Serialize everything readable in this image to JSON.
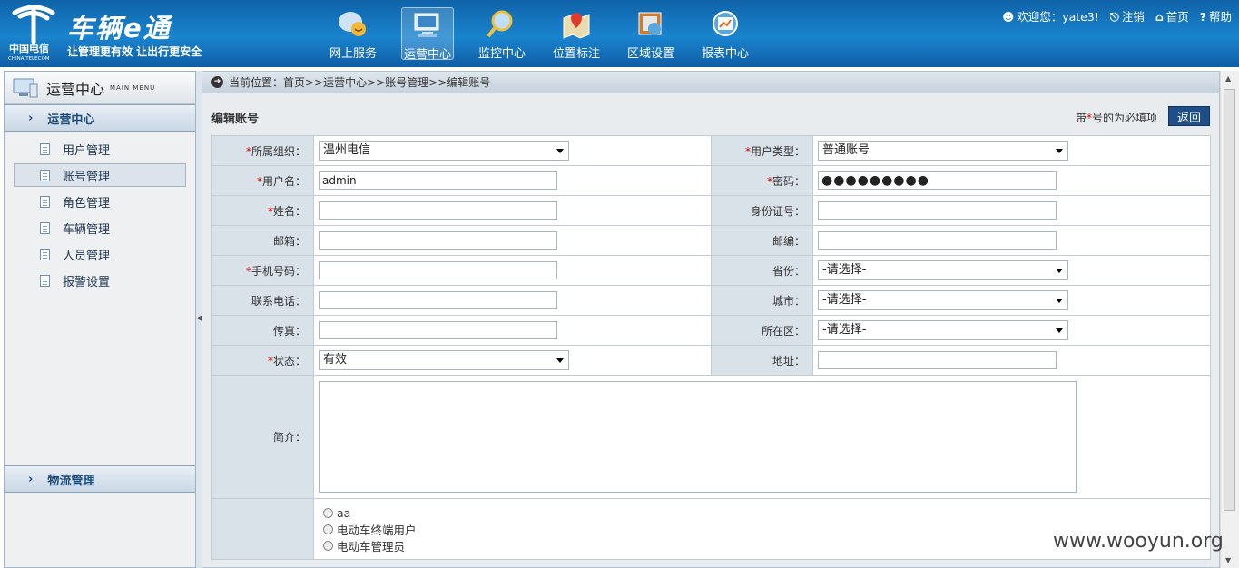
{
  "header": {
    "logo_sub": "中国电信",
    "logo_en": "CHINA TELECOM",
    "title": "车辆e通",
    "slogan": "让管理更有效 让出行更安全",
    "nav": [
      {
        "label": "网上服务",
        "icon": "chat-bubble-icon"
      },
      {
        "label": "运营中心",
        "icon": "monitor-icon"
      },
      {
        "label": "监控中心",
        "icon": "magnifier-icon"
      },
      {
        "label": "位置标注",
        "icon": "map-pin-icon"
      },
      {
        "label": "区域设置",
        "icon": "region-icon"
      },
      {
        "label": "报表中心",
        "icon": "report-icon"
      }
    ],
    "welcome": "欢迎您：yate3!",
    "logout": "注销",
    "home": "首页",
    "help": "帮助"
  },
  "sidebar": {
    "title": "运营中心",
    "title_sub": "MAIN MENU",
    "section1": "运营中心",
    "items": [
      "用户管理",
      "账号管理",
      "角色管理",
      "车辆管理",
      "人员管理",
      "报警设置"
    ],
    "section2": "物流管理"
  },
  "breadcrumb": "当前位置：首页>>运营中心>>账号管理>>编辑账号",
  "form": {
    "title": "编辑账号",
    "required_note_prefix": "带",
    "required_note_star": "*",
    "required_note_suffix": "号的为必填项",
    "back": "返回",
    "org_label": "所属组织：",
    "org_value": "温州电信",
    "usertype_label": "用户类型：",
    "usertype_value": "普通账号",
    "username_label": "用户名：",
    "username_value": "admin",
    "password_label": "密码：",
    "password_value": "●●●●●●●●●",
    "name_label": "姓名：",
    "idcard_label": "身份证号：",
    "email_label": "邮箱：",
    "zip_label": "邮编：",
    "mobile_label": "手机号码：",
    "province_label": "省份：",
    "province_value": "-请选择-",
    "phone_label": "联系电话：",
    "city_label": "城市：",
    "city_value": "-请选择-",
    "fax_label": "传真：",
    "district_label": "所在区：",
    "district_value": "-请选择-",
    "status_label": "状态：",
    "status_value": "有效",
    "address_label": "地址：",
    "intro_label": "简介：",
    "roles": [
      "aa",
      "电动车终端用户",
      "电动车管理员"
    ]
  },
  "watermark": "www.wooyun.org"
}
